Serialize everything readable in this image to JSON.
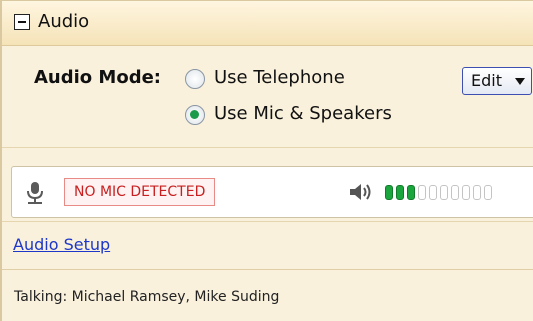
{
  "section": {
    "title": "Audio",
    "collapse_icon": "minus-icon"
  },
  "audio_mode": {
    "label": "Audio Mode:",
    "options": [
      {
        "label": "Use Telephone",
        "selected": false
      },
      {
        "label": "Use Mic & Speakers",
        "selected": true
      }
    ],
    "edit_button": {
      "label": "Edit",
      "icon": "caret-down-icon"
    }
  },
  "status": {
    "mic_icon": "microphone-icon",
    "mic_status": "NO MIC DETECTED",
    "speaker_icon": "speaker-volume-icon",
    "level": {
      "active": 3,
      "total": 10,
      "on_color": "#1aa63d",
      "off_color": "#ffffff"
    }
  },
  "audio_setup_link": "Audio Setup",
  "talking": "Talking: Michael Ramsey, Mike Suding"
}
